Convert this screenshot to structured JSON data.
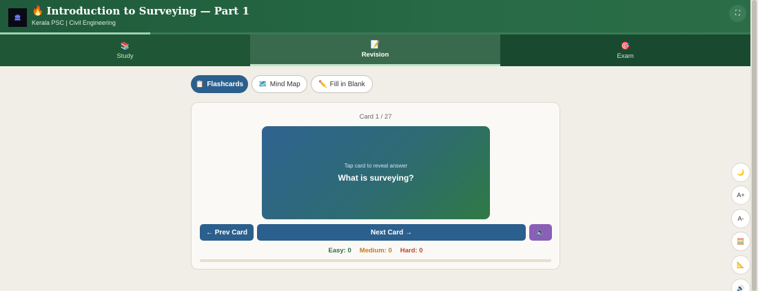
{
  "header": {
    "logo_text": "🏛",
    "title_icon": "🔥",
    "title": "Introduction to Surveying — Part 1",
    "subtitle": "Kerala PSC | Civil Engineering",
    "fullscreen_icon": "⛶",
    "progress_percent": 20
  },
  "tabs": [
    {
      "icon": "📚",
      "label": "Study"
    },
    {
      "icon": "📝",
      "label": "Revision"
    },
    {
      "icon": "🎯",
      "label": "Exam"
    }
  ],
  "modes": [
    {
      "icon": "📋",
      "label": "Flashcards"
    },
    {
      "icon": "🗺️",
      "label": "Mind Map"
    },
    {
      "icon": "✏️",
      "label": "Fill in Blank"
    }
  ],
  "card": {
    "counter": "Card 1 / 27",
    "hint": "Tap card to reveal answer",
    "question": "What is surveying?",
    "prev_label": "← Prev Card",
    "next_label": "Next Card →",
    "speak_icon": "🔈",
    "easy": "Easy: 0",
    "medium": "Medium: 0",
    "hard": "Hard: 0"
  },
  "tools": [
    {
      "icon": "🌙"
    },
    {
      "icon": "A+"
    },
    {
      "icon": "A-"
    },
    {
      "icon": "🧮"
    },
    {
      "icon": "📐"
    },
    {
      "icon": "🔊"
    }
  ],
  "colors": {
    "header": "#276a45",
    "accent_blue": "#2b5f8d",
    "speak_purple": "#8a5fb8"
  }
}
